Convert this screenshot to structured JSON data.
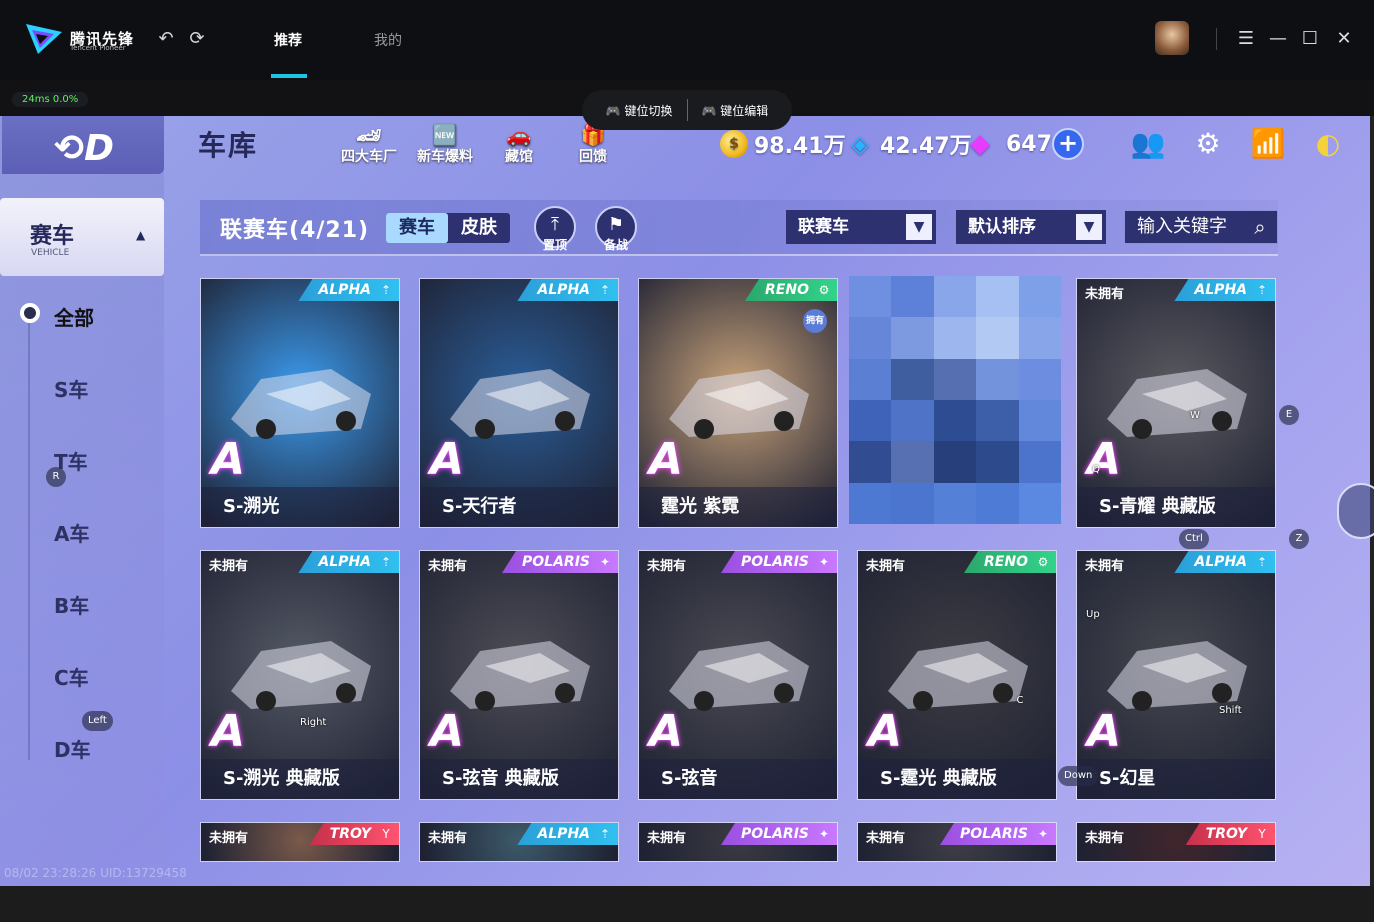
{
  "app": {
    "brand": "腾讯先锋",
    "brand_sub": "Tencent Pioneer",
    "nav": [
      {
        "label": "推荐",
        "active": true
      },
      {
        "label": "我的",
        "active": false
      }
    ],
    "icons": {
      "back": "undo-icon",
      "refresh": "refresh-icon",
      "menu": "menu-icon",
      "minimize": "minimize-icon",
      "maximize": "maximize-icon",
      "close": "close-icon"
    },
    "accent": "#1ec3e0"
  },
  "status": {
    "latency": "24ms",
    "loss": "0.0%",
    "uid_line": "08/02 23:28:26 UID:13729458"
  },
  "keymap": {
    "switch_label": "键位切换",
    "edit_label": "键位编辑"
  },
  "game": {
    "title": "车库",
    "header_buttons": [
      {
        "label": "四大车厂",
        "icon": "car-icon"
      },
      {
        "label": "新车爆料",
        "icon": "new-badge-icon"
      },
      {
        "label": "藏馆",
        "icon": "garage-icon"
      },
      {
        "label": "回馈",
        "icon": "gift-icon"
      }
    ],
    "currency": {
      "coins": "98.41万",
      "vouchers": "42.47万",
      "gems": "647"
    },
    "sidebar": {
      "tab_label": "赛车",
      "tab_sub": "VEHICLE",
      "categories": [
        "全部",
        "S车",
        "T车",
        "A车",
        "B车",
        "C车",
        "D车"
      ]
    },
    "filter": {
      "league_label": "联赛车(4/21)",
      "toggle": [
        "赛车",
        "皮肤"
      ],
      "pin_label": "置顶",
      "prepare_label": "备战",
      "type_select": "联赛车",
      "sort_select": "默认排序",
      "search_placeholder": "输入关键字"
    },
    "cards": [
      {
        "name": "S-溯光",
        "tag": "ALPHA",
        "tag_type": "alpha",
        "owned": true,
        "color": "#3b9cf0"
      },
      {
        "name": "S-天行者",
        "tag": "ALPHA",
        "tag_type": "alpha",
        "owned": true,
        "color": "#2a5e9a"
      },
      {
        "name": "霆光 紫霓",
        "tag": "RENO",
        "tag_type": "reno",
        "owned": true,
        "color": "#c9a37a"
      },
      {
        "name": "",
        "tag": "",
        "tag_type": "",
        "owned": true,
        "color": "#5a86d4"
      },
      {
        "name": "S-青耀 典藏版",
        "tag": "ALPHA",
        "tag_type": "alpha",
        "owned": false,
        "color": "#5b5a60"
      },
      {
        "name": "S-溯光 典藏版",
        "tag": "ALPHA",
        "tag_type": "alpha",
        "owned": false,
        "color": "#555a66"
      },
      {
        "name": "S-弦音 典藏版",
        "tag": "POLARIS",
        "tag_type": "polaris",
        "owned": false,
        "color": "#4d4d55"
      },
      {
        "name": "S-弦音",
        "tag": "POLARIS",
        "tag_type": "polaris",
        "owned": false,
        "color": "#4a4a52"
      },
      {
        "name": "S-霆光 典藏版",
        "tag": "RENO",
        "tag_type": "reno",
        "owned": false,
        "color": "#3c3c42"
      },
      {
        "name": "S-幻星",
        "tag": "ALPHA",
        "tag_type": "alpha",
        "owned": false,
        "color": "#46494f"
      },
      {
        "name": "",
        "tag": "TROY",
        "tag_type": "troy",
        "owned": false,
        "color": "#7a5a4a"
      },
      {
        "name": "",
        "tag": "ALPHA",
        "tag_type": "alpha",
        "owned": false,
        "color": "#3d5a6a"
      },
      {
        "name": "",
        "tag": "POLARIS",
        "tag_type": "polaris",
        "owned": false,
        "color": "#3a3a42"
      },
      {
        "name": "",
        "tag": "POLARIS",
        "tag_type": "polaris",
        "owned": false,
        "color": "#3e3e46"
      },
      {
        "name": "",
        "tag": "TROY",
        "tag_type": "troy",
        "owned": false,
        "color": "#40262c"
      }
    ],
    "not_owned_label": "未拥有",
    "owned_badge": "拥有",
    "grade_letter": "A",
    "key_hints": [
      "E",
      "W",
      "Q",
      "Ctrl",
      "Z",
      "R",
      "Right",
      "Left",
      "Up",
      "Shift",
      "C",
      "Down"
    ]
  }
}
